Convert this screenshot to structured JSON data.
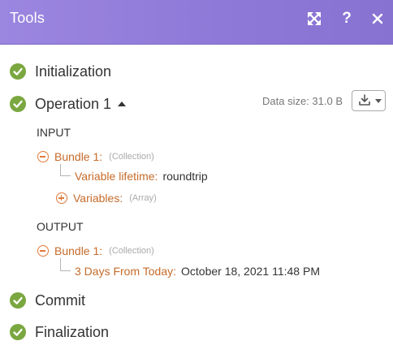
{
  "header": {
    "title": "Tools",
    "icons": [
      "expand-icon",
      "help-icon",
      "close-icon"
    ],
    "help_glyph": "?",
    "background": "#9080d8"
  },
  "stages": {
    "initialization": "Initialization",
    "operation": "Operation 1",
    "commit": "Commit",
    "finalization": "Finalization"
  },
  "operation": {
    "data_size": "Data size: 31.0 B",
    "input_label": "INPUT",
    "output_label": "OUTPUT",
    "input": {
      "bundle_key": "Bundle 1:",
      "bundle_type": "(Collection)",
      "variable_lifetime_key": "Variable lifetime:",
      "variable_lifetime_value": "roundtrip",
      "variables_key": "Variables:",
      "variables_type": "(Array)"
    },
    "output": {
      "bundle_key": "Bundle 1:",
      "bundle_type": "(Collection)",
      "date_key": "3 Days From Today:",
      "date_value": "October 18, 2021 11:48 PM"
    }
  },
  "colors": {
    "success": "#7aa73f",
    "key": "#c66b2a",
    "type": "#aaaaaa"
  }
}
